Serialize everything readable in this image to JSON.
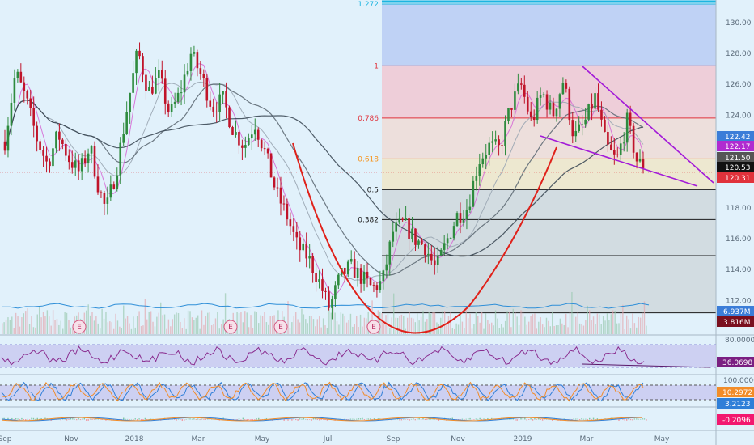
{
  "chart_data": [
    {
      "type": "candlestick",
      "title": "",
      "x_labels": [
        "Sep",
        "Nov",
        "2018",
        "Mar",
        "May",
        "Jul",
        "Sep",
        "Nov",
        "2019",
        "Mar",
        "May"
      ],
      "y_ticks": [
        "112.00",
        "114.00",
        "116.00",
        "118.00",
        "120.00",
        "122.00",
        "124.00",
        "126.00",
        "128.00",
        "130.00"
      ],
      "ylim": [
        110.5,
        131.2
      ],
      "price_path": [
        {
          "t": 0,
          "v": 122.3
        },
        {
          "t": 0.4,
          "v": 126.8
        },
        {
          "t": 0.8,
          "v": 125.0
        },
        {
          "t": 1.2,
          "v": 122.5
        },
        {
          "t": 1.6,
          "v": 120.8
        },
        {
          "t": 2.0,
          "v": 122.8
        },
        {
          "t": 2.4,
          "v": 121.2
        },
        {
          "t": 2.8,
          "v": 120.3
        },
        {
          "t": 3.2,
          "v": 122.0
        },
        {
          "t": 3.5,
          "v": 119.5
        },
        {
          "t": 3.8,
          "v": 117.8
        },
        {
          "t": 4.2,
          "v": 120.5
        },
        {
          "t": 4.6,
          "v": 124.5
        },
        {
          "t": 5.0,
          "v": 128.2
        },
        {
          "t": 5.4,
          "v": 125.5
        },
        {
          "t": 5.8,
          "v": 126.5
        },
        {
          "t": 6.2,
          "v": 124.0
        },
        {
          "t": 6.6,
          "v": 125.5
        },
        {
          "t": 7.0,
          "v": 128.0
        },
        {
          "t": 7.4,
          "v": 126.5
        },
        {
          "t": 7.8,
          "v": 124.5
        },
        {
          "t": 8.2,
          "v": 125.0
        },
        {
          "t": 8.6,
          "v": 123.0
        },
        {
          "t": 9.0,
          "v": 122.0
        },
        {
          "t": 9.4,
          "v": 123.5
        },
        {
          "t": 9.8,
          "v": 121.5
        },
        {
          "t": 10.2,
          "v": 119.0
        },
        {
          "t": 10.6,
          "v": 117.5
        },
        {
          "t": 11.0,
          "v": 115.5
        },
        {
          "t": 11.4,
          "v": 114.8
        },
        {
          "t": 11.8,
          "v": 113.3
        },
        {
          "t": 12.2,
          "v": 111.5
        },
        {
          "t": 12.6,
          "v": 113.5
        },
        {
          "t": 13.0,
          "v": 114.2
        },
        {
          "t": 13.4,
          "v": 113.5
        },
        {
          "t": 13.8,
          "v": 112.8
        },
        {
          "t": 14.2,
          "v": 113.2
        },
        {
          "t": 14.6,
          "v": 116.5
        },
        {
          "t": 15.0,
          "v": 117.0
        },
        {
          "t": 15.4,
          "v": 116.0
        },
        {
          "t": 15.8,
          "v": 115.5
        },
        {
          "t": 16.2,
          "v": 114.0
        },
        {
          "t": 16.6,
          "v": 115.8
        },
        {
          "t": 17.0,
          "v": 117.5
        },
        {
          "t": 17.4,
          "v": 118.0
        },
        {
          "t": 17.8,
          "v": 121.0
        },
        {
          "t": 18.2,
          "v": 122.0
        },
        {
          "t": 18.6,
          "v": 121.8
        },
        {
          "t": 19.0,
          "v": 124.5
        },
        {
          "t": 19.4,
          "v": 126.0
        },
        {
          "t": 19.8,
          "v": 123.5
        },
        {
          "t": 20.2,
          "v": 125.5
        },
        {
          "t": 20.6,
          "v": 124.0
        },
        {
          "t": 21.0,
          "v": 126.3
        },
        {
          "t": 21.4,
          "v": 122.5
        },
        {
          "t": 21.8,
          "v": 123.5
        },
        {
          "t": 22.2,
          "v": 125.2
        },
        {
          "t": 22.6,
          "v": 122.0
        },
        {
          "t": 23.0,
          "v": 121.0
        },
        {
          "t": 23.4,
          "v": 123.6
        },
        {
          "t": 23.8,
          "v": 120.8
        }
      ],
      "fib_levels": [
        {
          "label": "1.272",
          "value": 131.2,
          "color": "#1cb5e0"
        },
        {
          "label": "1",
          "value": 127.2,
          "color": "#e0323b"
        },
        {
          "label": "0.786",
          "value": 123.82,
          "color": "#e0323b"
        },
        {
          "label": "0.618",
          "value": 121.17,
          "color": "#f7931a"
        },
        {
          "label": "0.5",
          "value": 119.18,
          "color": "#1a1a1a"
        },
        {
          "label": "0.382",
          "value": 117.24,
          "color": "#1a1a1a"
        },
        {
          "label": "",
          "value": 114.9,
          "color": "#1a1a1a"
        },
        {
          "label": "",
          "value": 111.2,
          "color": "#1a1a1a"
        }
      ],
      "price_badges": [
        {
          "label": "122.42",
          "value": 122.42,
          "color": "#3b7dd8"
        },
        {
          "label": "122.17",
          "value": 122.17,
          "color": "#b02bd0"
        },
        {
          "label": "121.50",
          "value": 121.5,
          "color": "#555555"
        },
        {
          "label": "120.53",
          "value": 120.53,
          "color": "#111111"
        },
        {
          "label": "120.31",
          "value": 120.31,
          "color": "#e0323b"
        }
      ],
      "volume_badges": [
        "6.937M",
        "3.816M"
      ],
      "earnings_markers": [
        "E",
        "E",
        "E",
        "E"
      ],
      "earnings_t": [
        3.6,
        10.8,
        13.2,
        17.6
      ]
    },
    {
      "type": "line",
      "name": "RSI",
      "ylabel": "",
      "y_ticks": [
        "80.0000"
      ],
      "current_value": "36.0698",
      "ylim": [
        20,
        90
      ]
    },
    {
      "type": "line",
      "name": "Stochastic",
      "y_ticks": [
        "100.0000"
      ],
      "current_values": [
        "10.2972",
        "3.2123"
      ],
      "ylim": [
        0,
        110
      ]
    },
    {
      "type": "line",
      "name": "MACD",
      "current_value": "-0.2096"
    }
  ],
  "colors": {
    "background": "#e1f1fb",
    "up_candle": "#2e8b3e",
    "down_candle": "#c0142a",
    "cup_line": "#e0211a",
    "wedge_line": "#a31ad8",
    "rsi_band": "#c8c8f0"
  }
}
